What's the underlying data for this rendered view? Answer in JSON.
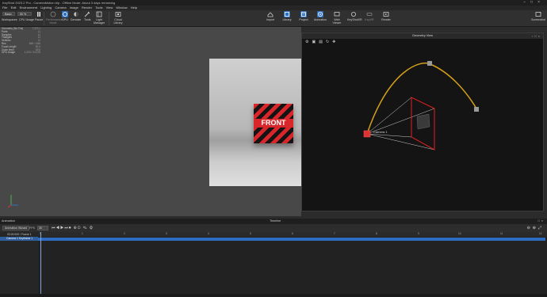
{
  "window": {
    "title": "KeyShot 2023.2 Pro - CameraMotion.bip - Offline Mode: About 3 days remaining"
  },
  "menu": [
    "File",
    "Edit",
    "Environment",
    "Lighting",
    "Camera",
    "Image",
    "Render",
    "Tools",
    "View",
    "Window",
    "Help"
  ],
  "toolbar": {
    "workspace_value": "Basic",
    "zoom_value": "50 %",
    "left_items": [
      {
        "label": "Workspaces"
      },
      {
        "label": "CPU Usage"
      },
      {
        "label": "Pause"
      },
      {
        "label": "Performance Mode"
      },
      {
        "label": "GPU"
      },
      {
        "label": "Denoise"
      },
      {
        "label": "Tools"
      },
      {
        "label": "Light Manager"
      },
      {
        "label": "Cloud Library"
      }
    ],
    "center_items": [
      {
        "label": "Import"
      },
      {
        "label": "Library"
      },
      {
        "label": "Project"
      },
      {
        "label": "Animation"
      },
      {
        "label": "Web Viewer"
      },
      {
        "label": "KeyShotXR"
      },
      {
        "label": "KeyVR"
      },
      {
        "label": "Render"
      }
    ],
    "right_item": {
      "label": "Screenshot"
    }
  },
  "scene_info": [
    {
      "name": "Geometry (No Tris)",
      "value": "7,373.1"
    },
    {
      "name": "Parts",
      "value": "11"
    },
    {
      "name": "Samples",
      "value": "11"
    },
    {
      "name": "Triangles",
      "value": "11"
    },
    {
      "name": "Vertices",
      "value": "11"
    },
    {
      "name": "Res",
      "value": "848 × 656"
    },
    {
      "name": "Focal Length",
      "value": "50.0"
    },
    {
      "name": "Zoom level",
      "value": "25%"
    },
    {
      "name": "GPU Usage",
      "value": "1,203 / 24,576"
    }
  ],
  "viewport": {
    "cube_label": "FRONT"
  },
  "geometry_view": {
    "title": "Geometry View",
    "camera_label": "Camera 1"
  },
  "animation": {
    "panel_title": "Animation",
    "timeline_title": "Timeline",
    "view_button": "Animation Wizard",
    "fps_label": "FPS",
    "fps_value": "30",
    "time_readout": "00:00.000 / Frame 1",
    "track_item": "Camera 1 Keyframe 1",
    "ruler_ticks": [
      "0",
      "1",
      "2",
      "3",
      "4",
      "5",
      "6",
      "7",
      "8",
      "9",
      "10",
      "11",
      "12"
    ]
  },
  "colors": {
    "accent": "#2f6fbf",
    "cube_red": "#d8262b",
    "path_yellow": "#d4a017",
    "frustum_red": "#e02020"
  }
}
